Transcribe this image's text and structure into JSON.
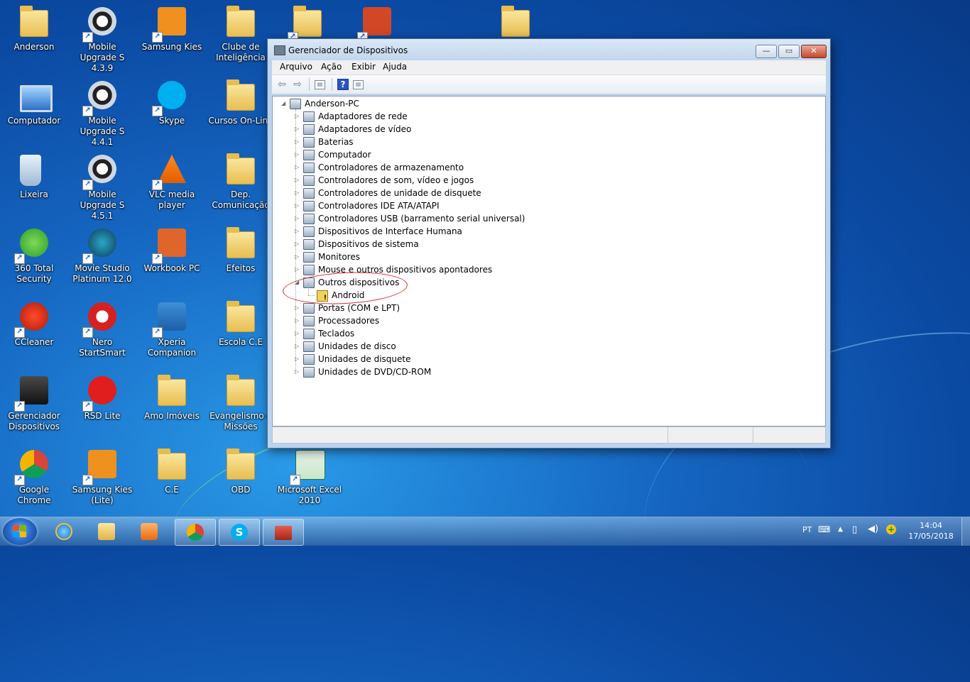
{
  "desktop": {
    "icons": [
      {
        "label": "Anderson",
        "icon": "user-folder"
      },
      {
        "label": "Mobile Upgrade S 4.3.9",
        "icon": "gear"
      },
      {
        "label": "Samsung Kies",
        "icon": "kies"
      },
      {
        "label": "Clube de Inteligência",
        "icon": "folder"
      },
      {
        "label": "",
        "icon": "folder-docs"
      },
      {
        "label": "",
        "icon": "powerpoint"
      },
      {
        "label": "",
        "icon": "folder"
      },
      {
        "label": "Computador",
        "icon": "computer"
      },
      {
        "label": "Mobile Upgrade S 4.4.1",
        "icon": "gear"
      },
      {
        "label": "Skype",
        "icon": "skype"
      },
      {
        "label": "Cursos On-Line",
        "icon": "folder"
      },
      {
        "label": "Lixeira",
        "icon": "recycle-bin"
      },
      {
        "label": "Mobile Upgrade S 4.5.1",
        "icon": "gear"
      },
      {
        "label": "VLC media player",
        "icon": "vlc"
      },
      {
        "label": "Dep. Comunicação",
        "icon": "folder"
      },
      {
        "label": "360 Total Security",
        "icon": "security-360"
      },
      {
        "label": "Movie Studio Platinum 12.0",
        "icon": "movie-studio"
      },
      {
        "label": "Workbook PC",
        "icon": "workbook"
      },
      {
        "label": "Efeitos",
        "icon": "folder"
      },
      {
        "label": "CCleaner",
        "icon": "ccleaner"
      },
      {
        "label": "Nero StartSmart",
        "icon": "nero"
      },
      {
        "label": "Xperia Companion",
        "icon": "xperia"
      },
      {
        "label": "Escola C.E",
        "icon": "folder"
      },
      {
        "label": "Gerenciador Dispositivos",
        "icon": "device-manager"
      },
      {
        "label": "RSD Lite",
        "icon": "motorola"
      },
      {
        "label": "Amo Imóveis",
        "icon": "folder"
      },
      {
        "label": "Evangelismo e Missões",
        "icon": "folder"
      },
      {
        "label": "Google Chrome",
        "icon": "chrome"
      },
      {
        "label": "Samsung Kies (Lite)",
        "icon": "kies-lite"
      },
      {
        "label": "C.E",
        "icon": "folder"
      },
      {
        "label": "OBD",
        "icon": "folder"
      },
      {
        "label": "Microsoft Excel 2010",
        "icon": "excel"
      }
    ]
  },
  "window": {
    "title": "Gerenciador de Dispositivos",
    "menu": [
      "Arquivo",
      "Ação",
      "Exibir",
      "Ajuda"
    ],
    "tree": {
      "root": "Anderson-PC",
      "items": [
        "Adaptadores de rede",
        "Adaptadores de vídeo",
        "Baterias",
        "Computador",
        "Controladores de armazenamento",
        "Controladores de som, vídeo e jogos",
        "Controladores de unidade de disquete",
        "Controladores IDE ATA/ATAPI",
        "Controladores USB (barramento serial universal)",
        "Dispositivos de Interface Humana",
        "Dispositivos de sistema",
        "Monitores",
        "Mouse e outros dispositivos apontadores",
        "Outros dispositivos",
        "Portas (COM e LPT)",
        "Processadores",
        "Teclados",
        "Unidades de disco",
        "Unidades de disquete",
        "Unidades de DVD/CD-ROM"
      ],
      "expanded_item": "Outros dispositivos",
      "child": "Android"
    }
  },
  "taskbar": {
    "language": "PT",
    "time": "14:04",
    "date": "17/05/2018"
  }
}
